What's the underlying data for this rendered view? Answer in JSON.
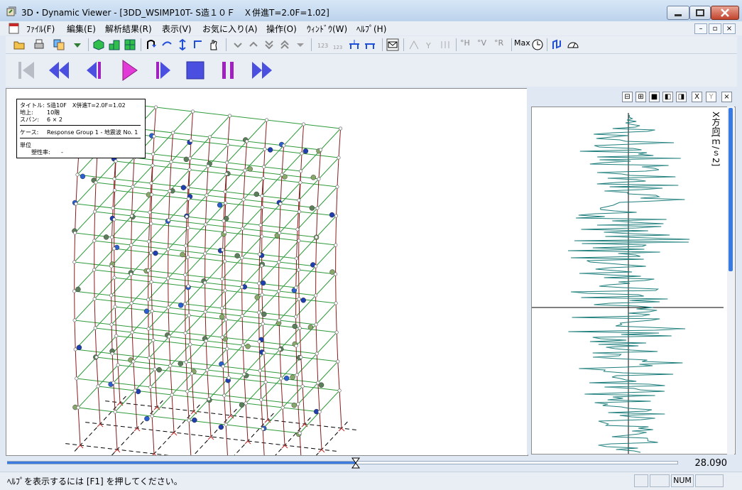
{
  "title_bar": {
    "text": "3D・Dynamic Viewer - [3DD_WSIMP10T- S造１０Ｆ　Ｘ併進T=2.0F=1.02]"
  },
  "menu": {
    "items": [
      "ﾌｧｲﾙ(F)",
      "編集(E)",
      "解析結果(R)",
      "表示(V)",
      "お気に入り(A)",
      "操作(O)",
      "ｳｨﾝﾄﾞｳ(W)",
      "ﾍﾙﾌﾟ(H)"
    ]
  },
  "toolbar": {
    "max_label": "Max",
    "h_label": "°H",
    "v_label": "°V",
    "r_label": "°R"
  },
  "info_box": {
    "title_label": "タイトル:",
    "title_value": "S造10F　X併進T=2.0F=1.02",
    "floors_label": "地上:",
    "floors_value": "10階",
    "span_label": "スパン:",
    "span_value": "6 × 2",
    "case_label": "ケース:",
    "case_value": "Response Group 1 - 地震波 No. 1",
    "unit_label": "単位",
    "plastic_label": "塑性率:",
    "plastic_value": "-"
  },
  "right_panel": {
    "buttons": [
      "⊟",
      "⊞",
      "■",
      "◧",
      "◨",
      "X",
      "Y",
      "×"
    ],
    "axis_label": "X方向[ｍ/ｓ2]"
  },
  "timeline": {
    "value": "28.090",
    "progress": 0.52
  },
  "status_bar": {
    "help_text": "ﾍﾙﾌﾟを表示するには [F1] を押してください。",
    "num": "NUM"
  },
  "colors": {
    "frame_green": "#2e9a3a",
    "column_brown": "#8b1c1c",
    "wave_teal": "#1e7f7c",
    "accent_blue": "#3b7be0"
  }
}
